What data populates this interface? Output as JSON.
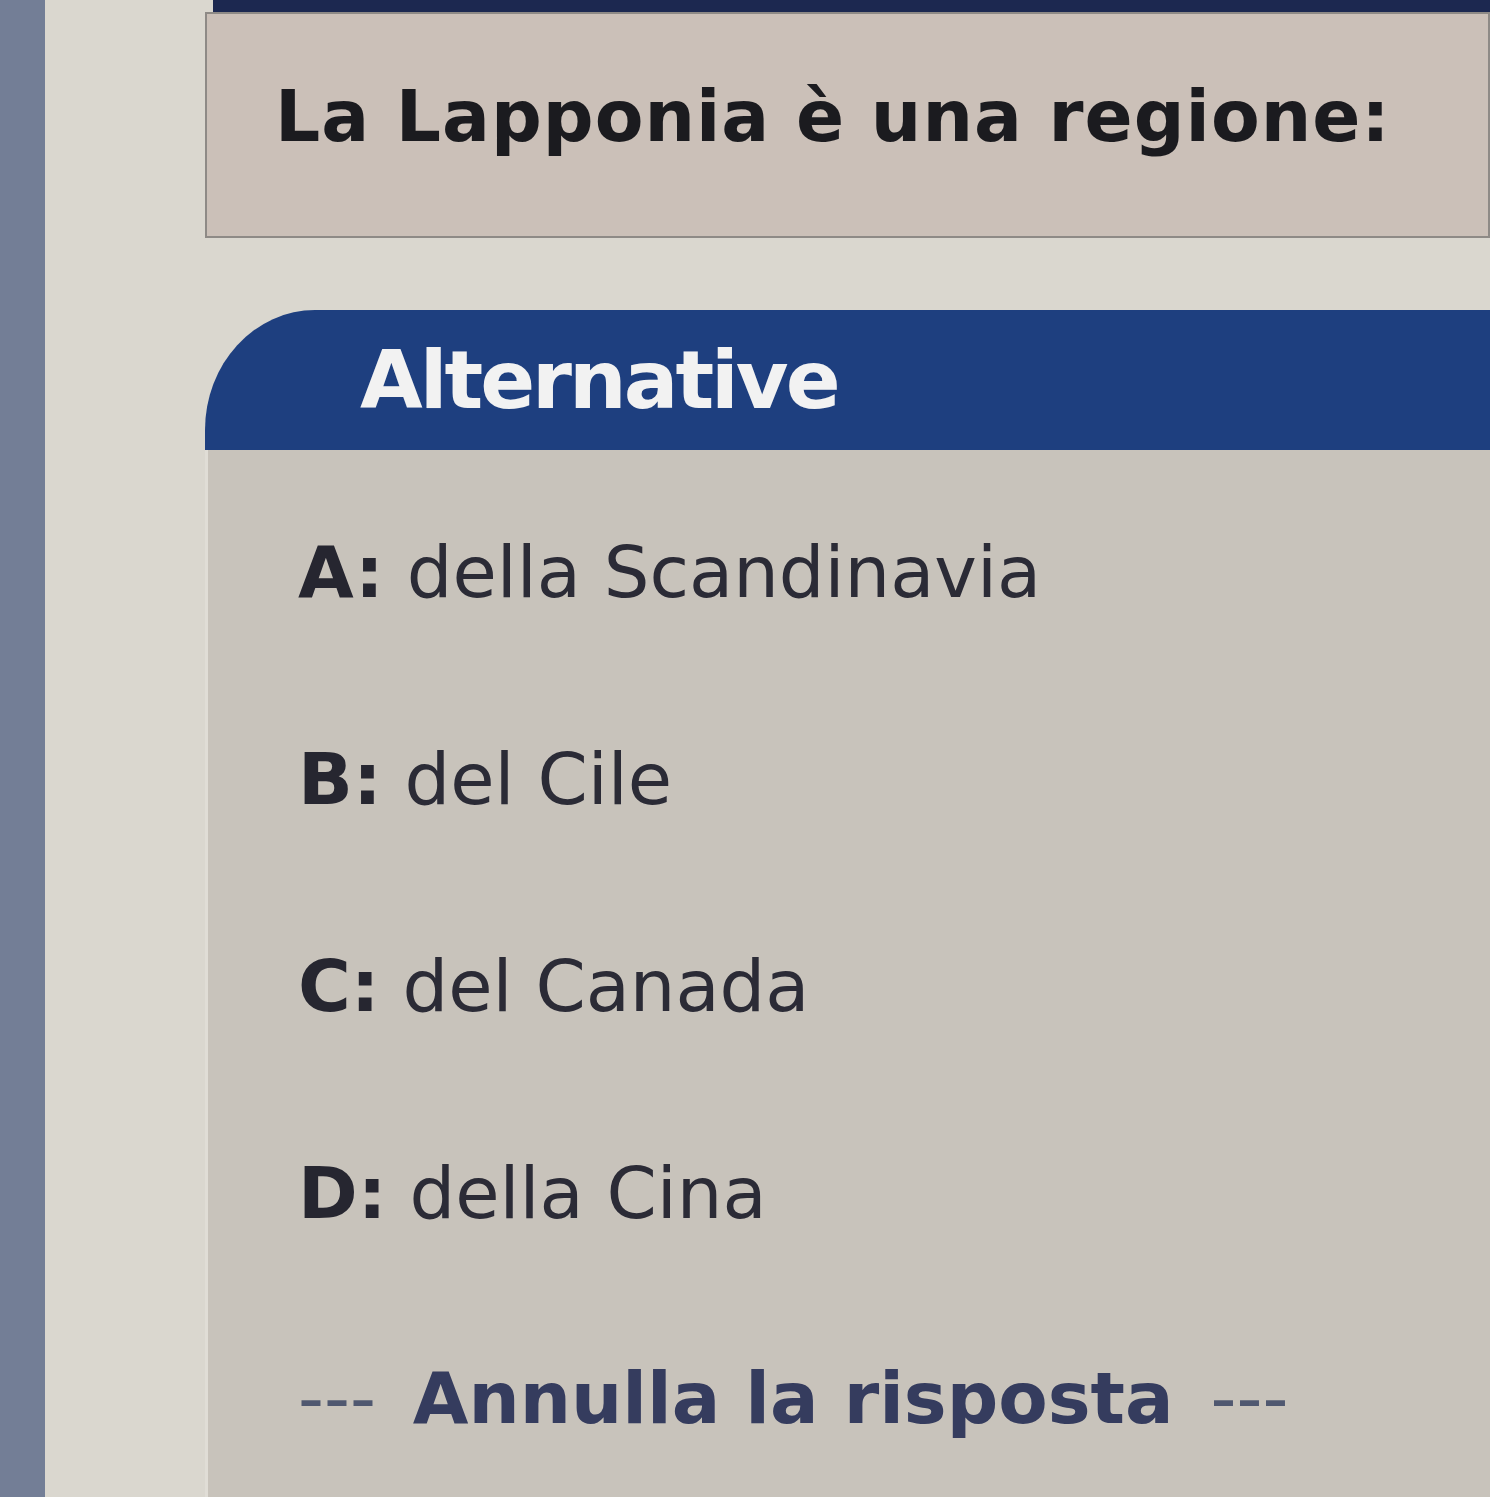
{
  "question": {
    "text": "La Lapponia è una regione:"
  },
  "alternatives": {
    "title": "Alternative",
    "options": [
      {
        "text": "**A:** della Scandinavia"
      },
      {
        "text": "**B:** del Cile"
      },
      {
        "text": "**C:** del Canada"
      },
      {
        "text": "**D:** della Cina"
      }
    ]
  },
  "cancel_link": {
    "text": "--- **Annulla la risposta** ---"
  }
}
